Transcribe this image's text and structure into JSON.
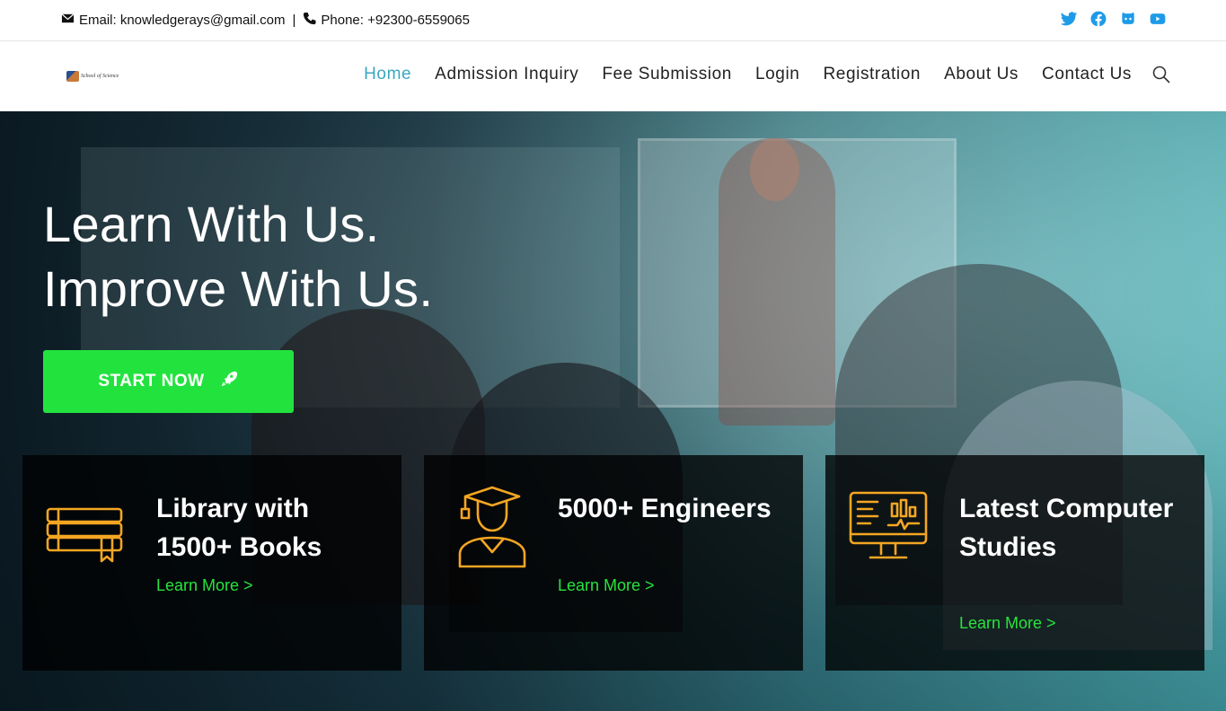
{
  "topbar": {
    "email_label": "Email: knowledgerays@gmail.com",
    "separator": "|",
    "phone_label": "Phone: +92300-6559065",
    "socials": [
      "twitter-icon",
      "facebook-icon",
      "github-icon",
      "youtube-icon"
    ]
  },
  "nav": {
    "logo_text": "School of Science",
    "items": [
      {
        "label": "Home",
        "active": true
      },
      {
        "label": "Admission Inquiry"
      },
      {
        "label": "Fee Submission"
      },
      {
        "label": "Login"
      },
      {
        "label": "Registration"
      },
      {
        "label": "About Us"
      },
      {
        "label": "Contact Us"
      }
    ]
  },
  "hero": {
    "line1": "Learn With Us.",
    "line2": "Improve With Us.",
    "button_label": "START NOW"
  },
  "cards": [
    {
      "title": "Library with 1500+ Books",
      "link": "Learn More >",
      "icon": "books-icon"
    },
    {
      "title": "5000+ Engineers",
      "link": "Learn More >",
      "icon": "graduate-icon"
    },
    {
      "title": "Latest Computer Studies",
      "link": "Learn More >",
      "icon": "computer-analytics-icon"
    }
  ],
  "colors": {
    "accent_nav": "#3aa6c1",
    "button_green": "#22e33e",
    "link_green": "#27e43d",
    "icon_orange": "#f4a622",
    "social_blue": "#1e9be8"
  }
}
